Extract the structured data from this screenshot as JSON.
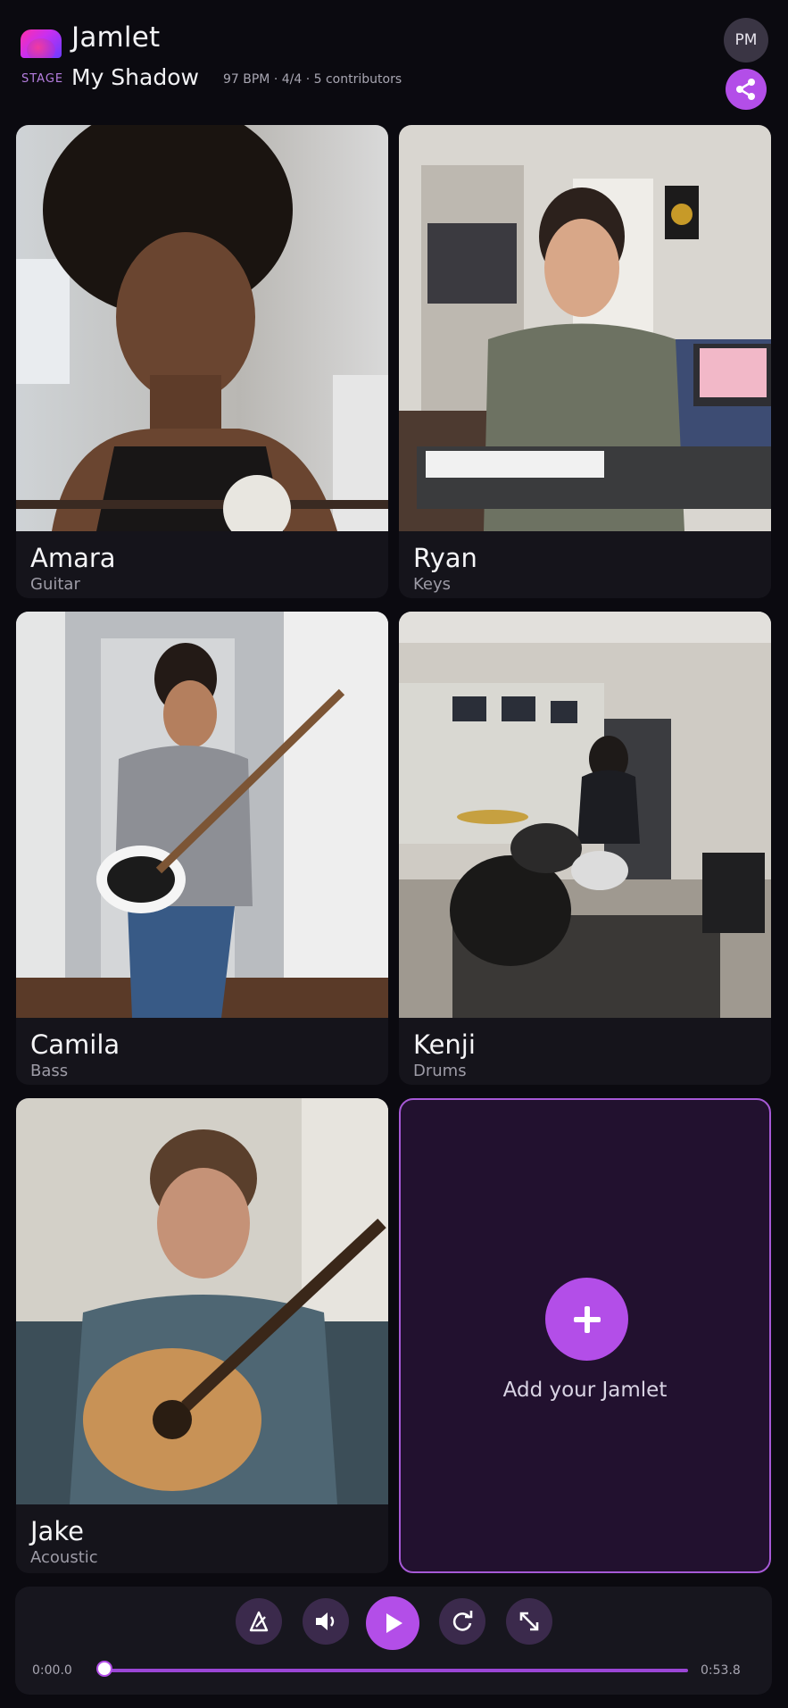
{
  "app": {
    "title": "Jamlet",
    "user_initials": "PM"
  },
  "stage": {
    "label": "STAGE",
    "song_title": "My Shadow",
    "meta": "97 BPM · 4/4 · 5 contributors"
  },
  "musicians": [
    {
      "name": "Amara",
      "instrument": "Guitar"
    },
    {
      "name": "Ryan",
      "instrument": "Keys"
    },
    {
      "name": "Camila",
      "instrument": "Bass"
    },
    {
      "name": "Kenji",
      "instrument": "Drums"
    },
    {
      "name": "Jake",
      "instrument": "Acoustic"
    }
  ],
  "add_tile": {
    "label": "Add your Jamlet"
  },
  "player": {
    "current_time": "0:00.0",
    "total_time": "0:53.8",
    "progress": 0.0,
    "controls": [
      "metronome-icon",
      "volume-icon",
      "play-icon",
      "loop-icon",
      "expand-icon"
    ]
  },
  "colors": {
    "accent": "#b34ee8",
    "background": "#0b0a10",
    "tile": "#15141b",
    "add_tile_bg": "#22112f"
  }
}
